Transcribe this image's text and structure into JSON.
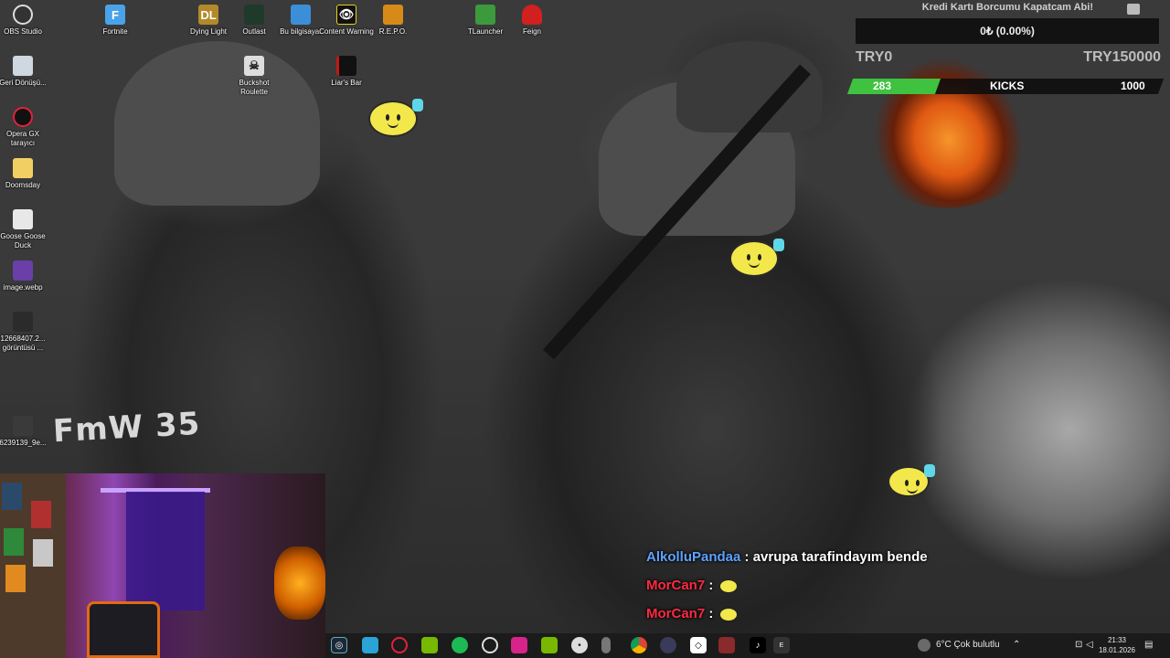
{
  "desktop_icons": [
    {
      "label": "OBS Studio",
      "icon": "obs-icon"
    },
    {
      "label": "Fortnite",
      "icon": "fortnite-icon"
    },
    {
      "label": "Dying Light",
      "icon": "dying-light-icon"
    },
    {
      "label": "Outlast",
      "icon": "outlast-icon"
    },
    {
      "label": "Bu bilgisayar",
      "icon": "computer-icon"
    },
    {
      "label": "Content Warning",
      "icon": "content-warning-icon"
    },
    {
      "label": "R.E.P.O.",
      "icon": "repo-icon"
    },
    {
      "label": "TLauncher",
      "icon": "tlauncher-icon"
    },
    {
      "label": "Feign",
      "icon": "feign-icon"
    },
    {
      "label": "Buckshot Roulette",
      "icon": "buckshot-icon"
    },
    {
      "label": "Liar's Bar",
      "icon": "liars-bar-icon"
    },
    {
      "label": "Geri Dönüşü...",
      "icon": "recycle-bin-icon"
    },
    {
      "label": "Opera GX tarayıcı",
      "icon": "opera-gx-icon"
    },
    {
      "label": "Doomsday",
      "icon": "folder-icon"
    },
    {
      "label": "Goose Goose Duck",
      "icon": "goose-icon"
    },
    {
      "label": "image.webp",
      "icon": "image-file-icon"
    },
    {
      "label": "12668407.2... görüntüsü ...",
      "icon": "image-file-icon"
    },
    {
      "label": "6239139_9e...",
      "icon": "image-file-icon"
    }
  ],
  "wallpaper_text": "FmW 35",
  "goal": {
    "title": "Kredi Kartı Borcumu Kapatcam Abi!",
    "amount": "0₺ (0.00%)",
    "min": "TRY0",
    "max": "TRY150000"
  },
  "kicks": {
    "current": "283",
    "label": "KICKS",
    "max": "1000",
    "progress": 0.283,
    "accent": "#3fc23f"
  },
  "chat": [
    {
      "user": "AlkolluPandaa",
      "separator": ":",
      "message": "avrupa tarafindayım bende",
      "user_color": "#5ea2ff"
    },
    {
      "user": "MorCan7",
      "separator": ":",
      "message": "",
      "user_color": "#ff2a42"
    },
    {
      "user": "MorCan7",
      "separator": ":",
      "message": "",
      "user_color": "#ff2a42"
    }
  ],
  "taskbar": {
    "apps": [
      "steam-icon",
      "photos-icon",
      "opera-gx-icon",
      "nvidia-icon",
      "spotify-icon",
      "obs-icon",
      "instagram-icon",
      "nvidia-icon",
      "discord-icon",
      "microphone-icon",
      "chrome-icon",
      "app-icon",
      "capcut-icon",
      "app-icon",
      "tiktok-icon",
      "epic-games-icon"
    ],
    "weather": "6°C  Çok bulutlu",
    "time": "21:33",
    "date": "18.01.2026"
  }
}
